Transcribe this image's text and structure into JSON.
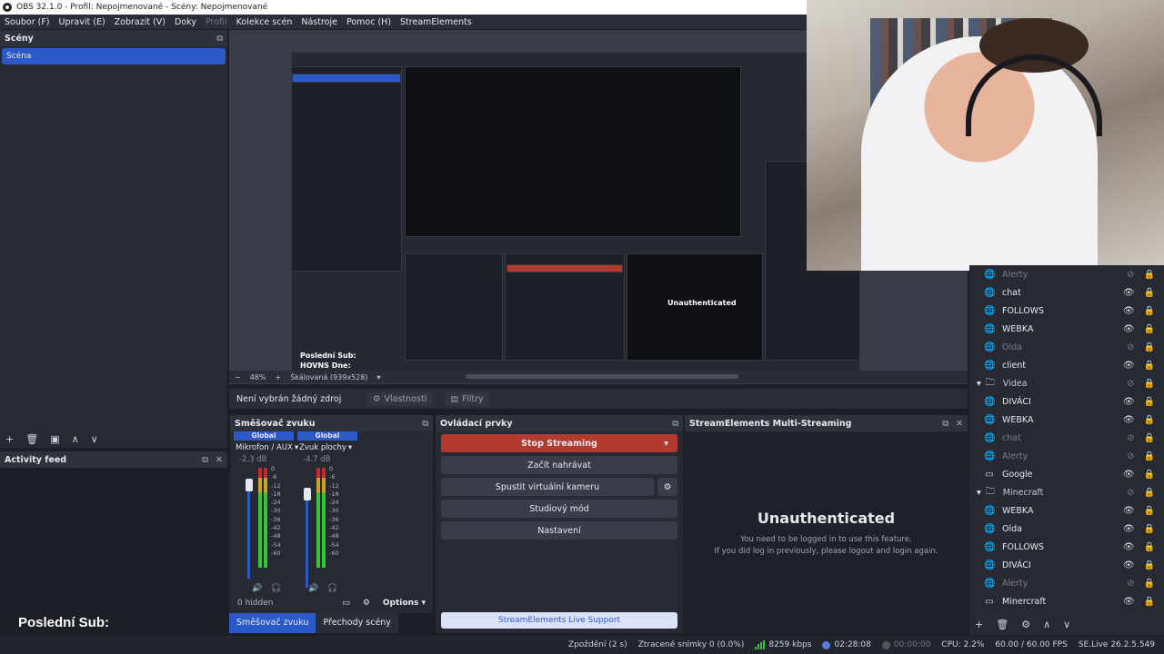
{
  "window": {
    "title": "OBS 32.1.0 - Profil: Nepojmenované - Scény: Nepojmenované"
  },
  "menu": [
    {
      "label": "Soubor (F)",
      "enabled": true
    },
    {
      "label": "Upravit (E)",
      "enabled": true
    },
    {
      "label": "Zobrazit (V)",
      "enabled": true
    },
    {
      "label": "Doky",
      "enabled": true
    },
    {
      "label": "Profil",
      "enabled": false
    },
    {
      "label": "Kolekce scén",
      "enabled": true
    },
    {
      "label": "Nástroje",
      "enabled": true
    },
    {
      "label": "Pomoc (H)",
      "enabled": true
    },
    {
      "label": "StreamElements",
      "enabled": true
    }
  ],
  "scenes": {
    "title": "Scény",
    "items": [
      "Scéna"
    ]
  },
  "activity": {
    "title": "Activity feed"
  },
  "preview": {
    "zoom": "48%",
    "scale": "Škálovaná (939x528)",
    "overlay_line1": "Poslední Sub:",
    "overlay_line2": "HOVNS Dne:"
  },
  "context": {
    "no_source": "Není vybrán žádný zdroj",
    "properties": "Vlastnosti",
    "filters": "Filtry"
  },
  "mixer": {
    "title": "Směšovač zvuku",
    "channels": [
      {
        "global": "Global",
        "name": "Mikrofon / AUX",
        "db": "-2.3 dB"
      },
      {
        "global": "Global",
        "name": "Zvuk plochy",
        "db": "-4.7 dB"
      }
    ],
    "scale": [
      "0",
      "-6",
      "-12",
      "-18",
      "-24",
      "-30",
      "-36",
      "-42",
      "-48",
      "-54",
      "-60"
    ],
    "hidden": "0 hidden",
    "options": "Options"
  },
  "controls": {
    "title": "Ovládací prvky",
    "stop_streaming": "Stop Streaming",
    "record": "Začít nahrávat",
    "virtual_cam": "Spustit virtuální kameru",
    "studio": "Studiový mód",
    "settings": "Nastavení",
    "support": "StreamElements Live Support"
  },
  "multistream": {
    "title": "StreamElements Multi-Streaming",
    "heading": "Unauthenticated",
    "line1": "You need to be logged in to use this feature.",
    "line2": "If you did log in previously, please logout and login again."
  },
  "tabs": [
    "Směšovač zvuku",
    "Přechody scény"
  ],
  "sources": [
    {
      "label": "Alerty",
      "icon": "globe",
      "hidden": true,
      "child": false
    },
    {
      "label": "chat",
      "icon": "globe",
      "hidden": false,
      "child": false
    },
    {
      "label": "FOLLOWS",
      "icon": "globe",
      "hidden": false,
      "child": false
    },
    {
      "label": "WEBKA",
      "icon": "globe",
      "hidden": false,
      "child": false
    },
    {
      "label": "Olda",
      "icon": "globe",
      "hidden": true,
      "child": false
    },
    {
      "label": "client",
      "icon": "globe",
      "hidden": false,
      "child": false
    },
    {
      "label": "Videa",
      "icon": "folder",
      "hidden": true,
      "child": false,
      "folder": true
    },
    {
      "label": "DIVÁCI",
      "icon": "globe",
      "hidden": false,
      "child": true
    },
    {
      "label": "WEBKA",
      "icon": "globe",
      "hidden": false,
      "child": true
    },
    {
      "label": "chat",
      "icon": "globe",
      "hidden": true,
      "child": true
    },
    {
      "label": "Alerty",
      "icon": "globe",
      "hidden": true,
      "child": true
    },
    {
      "label": "Google",
      "icon": "window",
      "hidden": false,
      "child": true
    },
    {
      "label": "Minecraft",
      "icon": "folder",
      "hidden": true,
      "child": false,
      "folder": true
    },
    {
      "label": "WEBKA",
      "icon": "globe",
      "hidden": false,
      "child": true
    },
    {
      "label": "Olda",
      "icon": "globe",
      "hidden": false,
      "child": true
    },
    {
      "label": "FOLLOWS",
      "icon": "globe",
      "hidden": false,
      "child": true
    },
    {
      "label": "DIVÁCI",
      "icon": "globe",
      "hidden": false,
      "child": true
    },
    {
      "label": "Alerty",
      "icon": "globe",
      "hidden": true,
      "child": true
    },
    {
      "label": "Minercraft",
      "icon": "window",
      "hidden": false,
      "child": true
    }
  ],
  "status": {
    "delay": "Zpoždění (2 s)",
    "dropped": "Ztracené snímky 0 (0.0%)",
    "bitrate": "8259 kbps",
    "stream_time": "02:28:08",
    "rec_time": "00:00:00",
    "cpu": "CPU: 2.2%",
    "fps": "60.00 / 60.00 FPS",
    "version": "SE.Live 26.2.5.549"
  },
  "colors": {
    "accent": "#2c59c8",
    "stop": "#b33a2e",
    "bg": "#1d1f26",
    "panel": "#272a33"
  }
}
